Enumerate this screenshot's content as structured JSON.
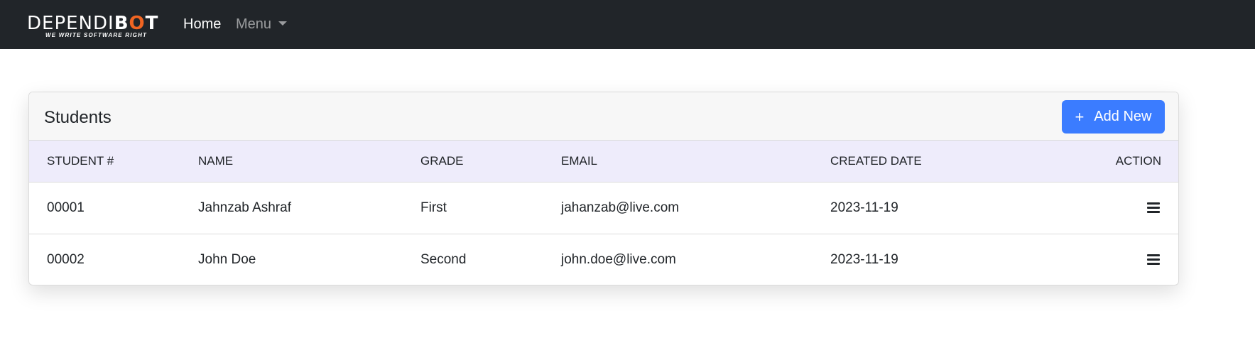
{
  "navbar": {
    "brand_light": "DEPENDI",
    "brand_bold_1": "B",
    "brand_accent": "O",
    "brand_bold_2": "T",
    "brand_tagline": "WE WRITE SOFTWARE RIGHT",
    "brand_accent_color": "#f16522",
    "home_label": "Home",
    "menu_label": "Menu",
    "menu_icon": "caret-down-icon"
  },
  "card": {
    "title": "Students",
    "add_button_icon": "plus-icon",
    "add_button_label": "Add New",
    "add_button_color": "#3b7cff"
  },
  "table": {
    "headers": {
      "student_no": "STUDENT #",
      "name": "NAME",
      "grade": "GRADE",
      "email": "EMAIL",
      "created_date": "CREATED DATE",
      "action": "ACTION"
    },
    "header_bg": "#eeecfb",
    "rows": [
      {
        "student_no": "00001",
        "name": "Jahnzab Ashraf",
        "grade": "First",
        "email": "jahanzab@live.com",
        "created_date": "2023-11-19",
        "action_icon": "hamburger-menu-icon"
      },
      {
        "student_no": "00002",
        "name": "John Doe",
        "grade": "Second",
        "email": "john.doe@live.com",
        "created_date": "2023-11-19",
        "action_icon": "hamburger-menu-icon"
      }
    ]
  }
}
